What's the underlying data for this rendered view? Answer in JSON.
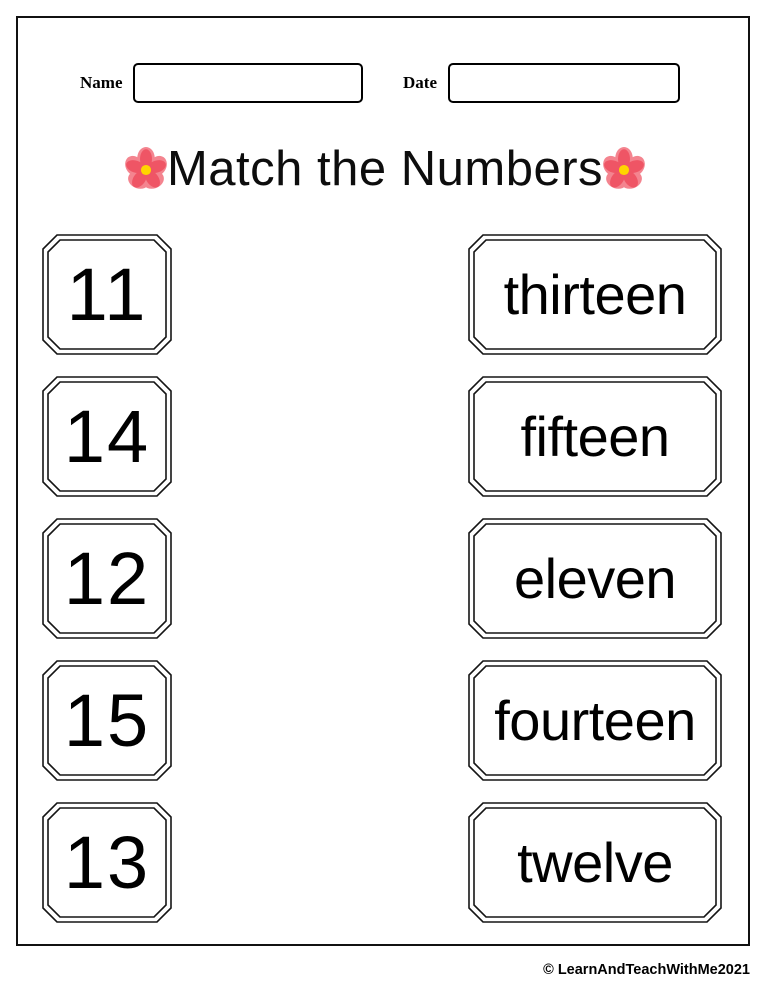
{
  "worksheet": {
    "title": "Match the Numbers",
    "flower_icon_left": "flower-icon",
    "flower_icon_right": "flower-icon",
    "flower_petal_color": "#ef5565",
    "flower_petal_light_color": "#f4848f",
    "flower_center_color": "#ffd400",
    "border_color": "#111111"
  },
  "header": {
    "name_label": "Name",
    "name_value": "",
    "name_placeholder": "",
    "date_label": "Date",
    "date_value": "",
    "date_placeholder": ""
  },
  "number_cards": [
    {
      "value": "11"
    },
    {
      "value": "14"
    },
    {
      "value": "12"
    },
    {
      "value": "15"
    },
    {
      "value": "13"
    }
  ],
  "word_cards": [
    {
      "value": "thirteen"
    },
    {
      "value": "fifteen"
    },
    {
      "value": "eleven"
    },
    {
      "value": "fourteen"
    },
    {
      "value": "twelve"
    }
  ],
  "footer": {
    "credit": "© LearnAndTeachWithMe2021"
  }
}
